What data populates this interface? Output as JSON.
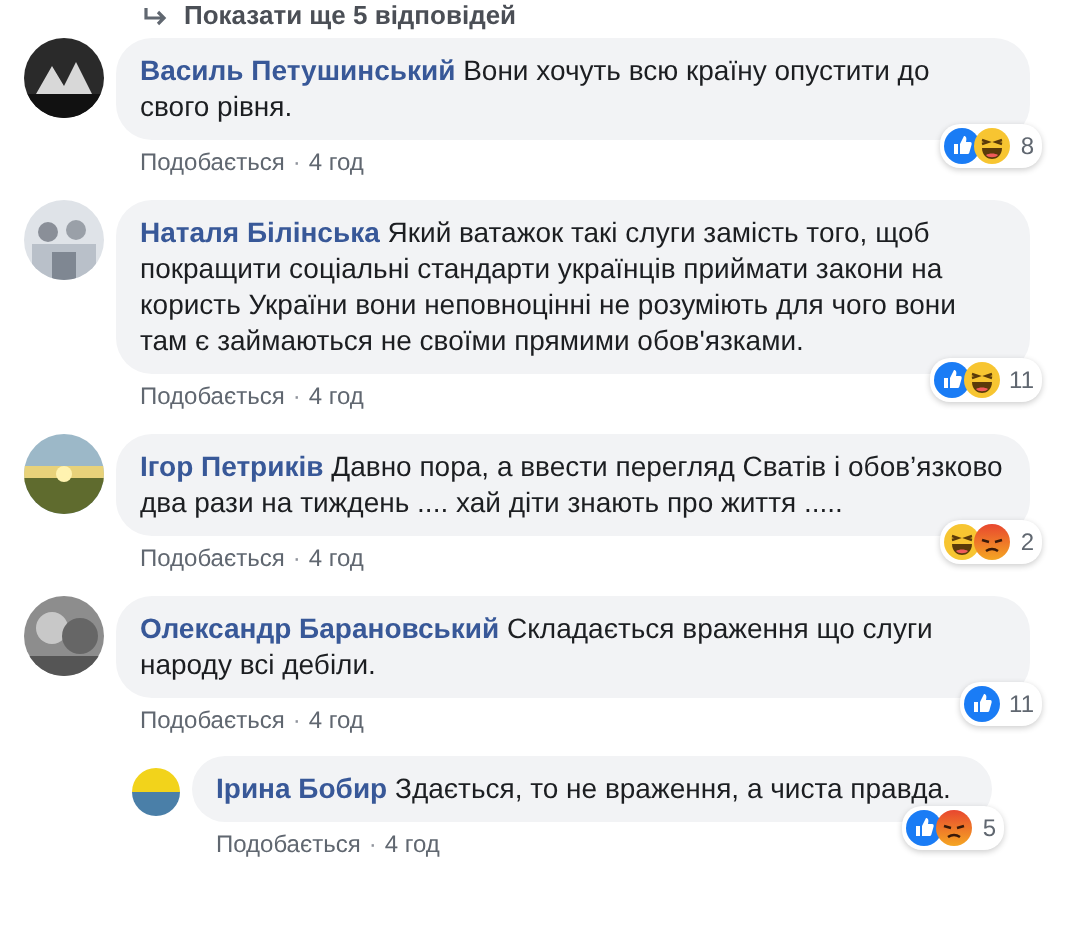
{
  "more_replies": {
    "label": "Показати ще 5 відповідей"
  },
  "separator": "·",
  "comments": [
    {
      "author": "Василь Петушинський",
      "text": "Вони хочуть всю країну опустити до свого рівня.",
      "like_label": "Подобається",
      "time": "4 год",
      "reactions": [
        {
          "kind": "like"
        },
        {
          "kind": "haha"
        }
      ],
      "reaction_count": "8"
    },
    {
      "author": "Наталя Білінська",
      "text": "Який ватажок такі слуги замість того, щоб покращити соціальні стандарти українців приймати закони на користь України вони неповноцінні не розуміють для чого вони там є займаються не своїми прямими обов'язками.",
      "like_label": "Подобається",
      "time": "4 год",
      "reactions": [
        {
          "kind": "like"
        },
        {
          "kind": "haha"
        }
      ],
      "reaction_count": "11"
    },
    {
      "author": "Ігор Петриків",
      "text": "Давно пора, а ввести перегляд Сватів і обов’язково два рази на тиждень .... хай діти знають про життя .....",
      "like_label": "Подобається",
      "time": "4 год",
      "reactions": [
        {
          "kind": "haha"
        },
        {
          "kind": "angry"
        }
      ],
      "reaction_count": "2"
    },
    {
      "author": "Олександр Барановський",
      "text": "Складається враження що слуги народу всі дебіли.",
      "like_label": "Подобається",
      "time": "4 год",
      "reactions": [
        {
          "kind": "like"
        }
      ],
      "reaction_count": "11",
      "replies": [
        {
          "author": "Ірина Бобир",
          "text": "Здається, то не враження, а чиста правда.",
          "like_label": "Подобається",
          "time": "4 год",
          "reactions": [
            {
              "kind": "like"
            },
            {
              "kind": "angry"
            }
          ],
          "reaction_count": "5"
        }
      ]
    }
  ]
}
